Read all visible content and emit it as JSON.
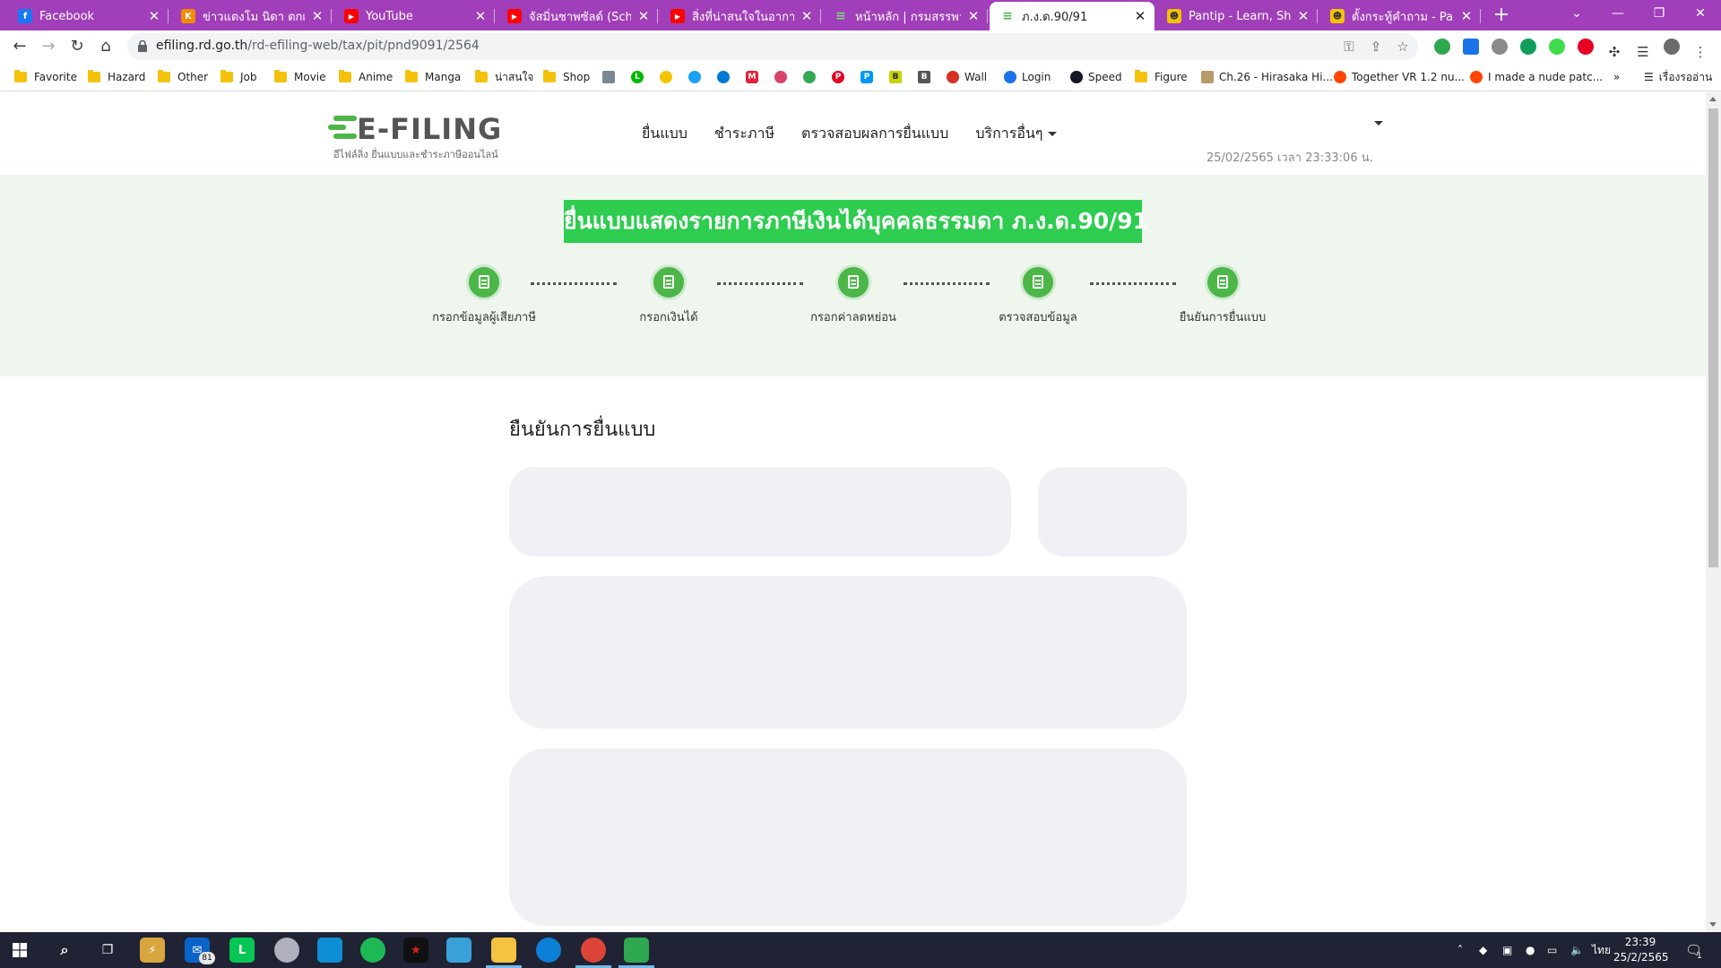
{
  "browser": {
    "tabs": [
      {
        "title": "Facebook",
        "favicon_color": "#1877f2",
        "favicon_glyph": "f",
        "active": false
      },
      {
        "title": "ข่าวแตงโม นิดา ตกเรือ ล่าสุด",
        "favicon_color": "#f28c00",
        "favicon_glyph": "K",
        "active": false
      },
      {
        "title": "YouTube",
        "favicon_color": "#ff0000",
        "favicon_glyph": "▶",
        "active": false
      },
      {
        "title": "จัสมิ่นซาพซัลด์ (Schwarz",
        "favicon_color": "#ff0000",
        "favicon_glyph": "▶",
        "active": false
      },
      {
        "title": "สิ่งที่น่าสนใจในอากาศที่เรา",
        "favicon_color": "#ff0000",
        "favicon_glyph": "▶",
        "active": false
      },
      {
        "title": "หน้าหลัก | กรมสรรพากร",
        "favicon_color": "#4cb748",
        "favicon_glyph": "≡",
        "active": false
      },
      {
        "title": "ภ.ง.ด.90/91",
        "favicon_color": "#4cb748",
        "favicon_glyph": "≡",
        "active": true
      },
      {
        "title": "Pantip - Learn, Share &",
        "favicon_color": "#f5c400",
        "favicon_glyph": "☻",
        "active": false
      },
      {
        "title": "ตั้งกระทู้คำถาม - Pantip",
        "favicon_color": "#f5c400",
        "favicon_glyph": "☻",
        "active": false
      }
    ],
    "new_tab_icon": "+",
    "window_controls": [
      "⌄",
      "—",
      "❐",
      "✕"
    ],
    "url_host": "efiling.rd.go.th",
    "url_path": "/rd-efiling-web/tax/pit/pnd9091/2564"
  },
  "bookmarks": [
    {
      "label": "Favorite",
      "type": "folder"
    },
    {
      "label": "Hazard",
      "type": "folder"
    },
    {
      "label": "Other",
      "type": "folder"
    },
    {
      "label": "Job",
      "type": "folder"
    },
    {
      "label": "Movie",
      "type": "folder"
    },
    {
      "label": "Anime",
      "type": "folder"
    },
    {
      "label": "Manga",
      "type": "folder"
    },
    {
      "label": "น่าสนใจ",
      "type": "folder"
    },
    {
      "label": "Shop",
      "type": "folder"
    },
    {
      "label": "Wall",
      "type": "site"
    },
    {
      "label": "Login",
      "type": "site"
    },
    {
      "label": "Speed",
      "type": "site"
    },
    {
      "label": "Figure",
      "type": "folder"
    },
    {
      "label": "Ch.26 - Hirasaka Hi...",
      "type": "site"
    },
    {
      "label": "Together VR 1.2 nu...",
      "type": "site"
    },
    {
      "label": "I made a nude patc...",
      "type": "site"
    },
    {
      "label": "»",
      "type": "more"
    },
    {
      "label": "เรื่องรออ่าน",
      "type": "reading-list"
    }
  ],
  "site": {
    "logo_text": "E-FILING",
    "logo_subtitle": "อีไฟล์ลิ่ง ยื่นแบบและชำระภาษีออนไลน์",
    "menu": [
      "ยื่นแบบ",
      "ชำระภาษี",
      "ตรวจสอบผลการยื่นแบบ",
      "บริการอื่นๆ"
    ],
    "datetime": "25/02/2565 เวลา 23:33:06 น.",
    "hero_title": "ยื่นแบบแสดงรายการภาษีเงินได้บุคคลธรรมดา ภ.ง.ด.90/91",
    "steps": [
      "กรอกข้อมูลผู้เสียภาษี",
      "กรอกเงินได้",
      "กรอกค่าลดหย่อน",
      "ตรวจสอบข้อมูล",
      "ยืนยันการยื่นแบบ"
    ],
    "section_title": "ยืนยันการยื่นแบบ",
    "accent_color": "#2ecc4f"
  },
  "taskbar": {
    "mail_badge": "81",
    "tray_lang": "ไทย",
    "clock_time": "23:39",
    "clock_date": "25/2/2565",
    "notification_count": "1"
  }
}
